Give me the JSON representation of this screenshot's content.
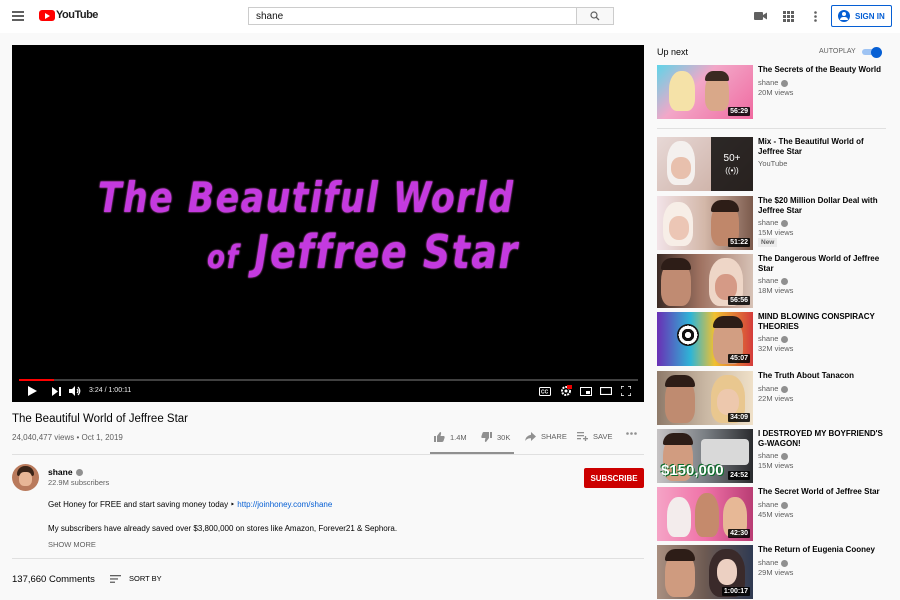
{
  "header": {
    "logo_text": "YouTube",
    "search_value": "shane",
    "sign_in_label": "SIGN IN"
  },
  "player": {
    "overlay_line1": "The Beautiful World",
    "overlay_line2_small": "of",
    "overlay_line2": "Jeffree Star",
    "timecode": "3:24 / 1:00:11",
    "progress": 0.056
  },
  "video": {
    "title": "The Beautiful World of Jeffree Star",
    "meta": "24,040,477 views • Oct 1, 2019",
    "likes": "1.4M",
    "dislikes": "30K",
    "share_label": "SHARE",
    "save_label": "SAVE"
  },
  "channel": {
    "name": "shane",
    "subs": "22.9M subscribers",
    "subscribe_label": "SUBSCRIBE"
  },
  "description": {
    "line1_text": "Get Honey for FREE and start saving money today ‣",
    "line1_link": "http://joinhoney.com/shane",
    "line2": "My subscribers have already saved over $3,800,000 on stores like Amazon, Forever21 & Sephora.",
    "show_more": "SHOW MORE"
  },
  "comments": {
    "count": "137,660 Comments",
    "sort_label": "SORT BY"
  },
  "sidebar": {
    "up_next": "Up next",
    "autoplay_label": "AUTOPLAY",
    "items": [
      {
        "title": "The Secrets of the Beauty World",
        "channel": "shane",
        "views": "20M views",
        "duration": "56:29"
      },
      {
        "title": "Mix - The Beautiful World of Jeffree Star",
        "channel": "YouTube",
        "mix_count": "50+"
      },
      {
        "title": "The $20 Million Dollar Deal with Jeffree Star",
        "channel": "shane",
        "views": "15M views",
        "duration": "51:22",
        "badge": "New"
      },
      {
        "title": "The Dangerous World of Jeffree Star",
        "channel": "shane",
        "views": "18M views",
        "duration": "56:56"
      },
      {
        "title": "MIND BLOWING CONSPIRACY THEORIES",
        "channel": "shane",
        "views": "32M views",
        "duration": "45:07"
      },
      {
        "title": "The Truth About Tanacon",
        "channel": "shane",
        "views": "22M views",
        "duration": "34:09"
      },
      {
        "title": "I DESTROYED MY BOYFRIEND'S G-WAGON!",
        "channel": "shane",
        "views": "15M views",
        "duration": "24:52",
        "thumb_text": "$150,000"
      },
      {
        "title": "The Secret World of Jeffree Star",
        "channel": "shane",
        "views": "45M views",
        "duration": "42:30"
      },
      {
        "title": "The Return of Eugenia Cooney",
        "channel": "shane",
        "views": "29M views",
        "duration": "1:00:17"
      }
    ]
  },
  "colors": {
    "brand_red": "#ff0000",
    "subscribe_red": "#cc0000",
    "link_blue": "#065fd4",
    "overlay_purple": "#c43adf"
  }
}
